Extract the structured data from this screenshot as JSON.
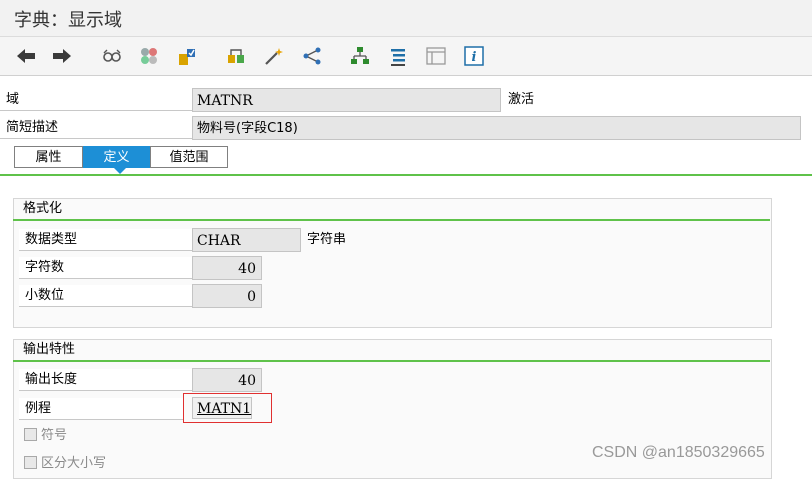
{
  "window": {
    "title": "字典：显示域"
  },
  "toolbar": {
    "buttons": [
      {
        "name": "back-arrow-icon"
      },
      {
        "name": "forward-arrow-icon"
      },
      {
        "name": "display-glasses-icon"
      },
      {
        "name": "toggle-other-icon"
      },
      {
        "name": "check-icon"
      },
      {
        "name": "activate-icon"
      },
      {
        "name": "magic-wand-icon"
      },
      {
        "name": "where-used-icon"
      },
      {
        "name": "hierarchy-icon"
      },
      {
        "name": "list-icon"
      },
      {
        "name": "layout-icon"
      },
      {
        "name": "info-icon"
      }
    ]
  },
  "header": {
    "domain_label": "域",
    "domain_value": "MATNR",
    "status": "激活",
    "desc_label": "简短描述",
    "desc_value": "物料号(字段C18)"
  },
  "tabs": [
    {
      "label": "属性",
      "active": false
    },
    {
      "label": "定义",
      "active": true
    },
    {
      "label": "值范围",
      "active": false
    }
  ],
  "format": {
    "title": "格式化",
    "datatype_label": "数据类型",
    "datatype_value": "CHAR",
    "datatype_desc": "字符串",
    "chars_label": "字符数",
    "chars_value": "40",
    "decimals_label": "小数位",
    "decimals_value": "0"
  },
  "output": {
    "title": "输出特性",
    "length_label": "输出长度",
    "length_value": "40",
    "routine_label": "例程",
    "routine_value": "MATN1",
    "sign_label": "符号",
    "case_label": "区分大小写"
  },
  "watermark": "CSDN @an1850329665",
  "colors": {
    "accent": "#1d8fd6",
    "green": "#5fc24a",
    "highlight": "#e03030"
  }
}
